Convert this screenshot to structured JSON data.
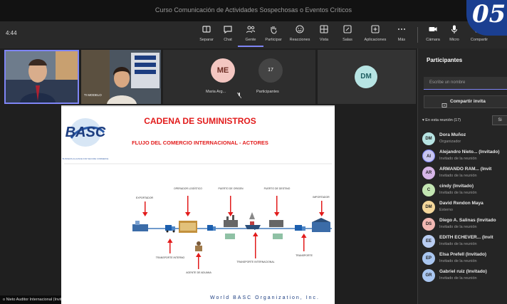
{
  "window": {
    "title": "Curso Comunicación de Actividades Sospechosas o Eventos Críticos",
    "clock": "4:44"
  },
  "badge": "05",
  "toolbar": {
    "items": [
      {
        "label": "Separar",
        "icon": "separate-icon"
      },
      {
        "label": "Chat",
        "icon": "chat-icon"
      },
      {
        "label": "Gente",
        "icon": "people-icon"
      },
      {
        "label": "Participar",
        "icon": "raise-hand-icon"
      },
      {
        "label": "Reacciones",
        "icon": "reactions-icon"
      },
      {
        "label": "Vista",
        "icon": "view-icon"
      },
      {
        "label": "Salas",
        "icon": "rooms-icon"
      },
      {
        "label": "Aplicaciones",
        "icon": "apps-icon"
      },
      {
        "label": "Más",
        "icon": "more-icon"
      },
      {
        "label": "Cámara",
        "icon": "camera-icon"
      },
      {
        "label": "Micro",
        "icon": "mic-icon"
      },
      {
        "label": "Compartir",
        "icon": "share-icon"
      }
    ]
  },
  "stage": {
    "tiles": [
      {
        "initials": "ME",
        "name": "Maria Arg...",
        "color": "#f3c6c1"
      },
      {
        "initials": "17",
        "name": "Participantes"
      },
      {
        "initials": "DM",
        "color": "#b7e4e3"
      }
    ],
    "person_label": "TI MODELO",
    "presenter_label": "o Nieto Auditor Internacional (Invitado)"
  },
  "slide": {
    "title": "CADENA DE SUMINISTROS",
    "subtitle": "FLUJO DEL COMERCIO INTERNACIONAL - ACTORES",
    "logo": "BASC",
    "logo_sub": "BUSINESS ALLIANCE FOR SECURE COMMERCE",
    "footer": "World BASC Organization, Inc.",
    "top_labels": [
      "EXPORTADOR",
      "OPERADOR LOGÍSTICO",
      "PUERTO DE ORIGEN",
      "PUERTO DE DESTINO",
      "IMPORTADOR"
    ],
    "bottom_labels": [
      "TRANSPORTE INTERNO",
      "AGENTE DE ADUANA",
      "TRANSPORTE INTERNACIONAL",
      "TRANSPORTE"
    ]
  },
  "panel": {
    "title": "Participantes",
    "search_placeholder": "Escribe un nombre",
    "share_label": "Compartir invita",
    "section_label": "En esta reunión (17)",
    "section_btn": "Si",
    "people": [
      {
        "initials": "DM",
        "name": "Dora Muñoz",
        "role": "Organizador",
        "color": "#b7e4e3"
      },
      {
        "initials": "AI",
        "name": "Alejandro Nieto... (Invitado)",
        "role": "Invitado de la reunión",
        "color": "#c8c6f1"
      },
      {
        "initials": "AR",
        "name": "ARMANDO RAM... (Invit",
        "role": "Invitado de la reunión",
        "color": "#d7b6e8"
      },
      {
        "initials": "C",
        "name": "cindy (Invitado)",
        "role": "Invitado de la reunión",
        "color": "#c3e6b2"
      },
      {
        "initials": "DM",
        "name": "David Rendon Maya",
        "role": "Externo",
        "color": "#f4d79b"
      },
      {
        "initials": "DS",
        "name": "Diego A. Salinas (Invitado",
        "role": "Invitado de la reunión",
        "color": "#f2b8b3"
      },
      {
        "initials": "EE",
        "name": "EDITH ECHEVER... (Invit",
        "role": "Invitado de la reunión",
        "color": "#b9cdf2"
      },
      {
        "initials": "EP",
        "name": "Elsa Prefell (Invitado)",
        "role": "Invitado de la reunión",
        "color": "#a9c6f0"
      },
      {
        "initials": "GR",
        "name": "Gabriel ruiz (Invitado)",
        "role": "Invitado de la reunión",
        "color": "#a9c6f0"
      }
    ]
  }
}
